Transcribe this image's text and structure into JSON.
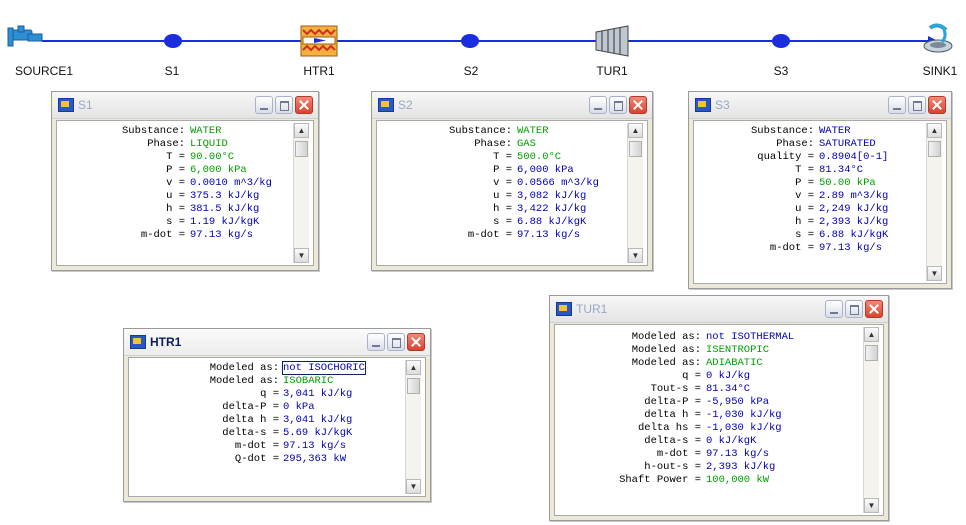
{
  "flowsheet": {
    "nodes": {
      "source": "SOURCE1",
      "s1": "S1",
      "htr": "HTR1",
      "s2": "S2",
      "tur": "TUR1",
      "s3": "S3",
      "sink": "SINK1"
    },
    "line_color": "#1a2ee0"
  },
  "win_s1": {
    "title": "S1",
    "rows": [
      {
        "label": "Substance:",
        "value": "WATER"
      },
      {
        "label": "Phase:",
        "value": "LIQUID"
      },
      {
        "label": "T =",
        "value": "90.00°C"
      },
      {
        "label": "P =",
        "value": "6,000 kPa"
      },
      {
        "label": "v =",
        "value": "0.0010 m^3/kg"
      },
      {
        "label": "u =",
        "value": "375.3 kJ/kg"
      },
      {
        "label": "h =",
        "value": "381.5 kJ/kg"
      },
      {
        "label": "s =",
        "value": "1.19 kJ/kgK"
      },
      {
        "label": "m-dot =",
        "value": "97.13 kg/s"
      }
    ]
  },
  "win_s2": {
    "title": "S2",
    "rows": [
      {
        "label": "Substance:",
        "value": "WATER"
      },
      {
        "label": "Phase:",
        "value": "GAS"
      },
      {
        "label": "T =",
        "value": "500.0°C"
      },
      {
        "label": "P =",
        "value": "6,000 kPa"
      },
      {
        "label": "v =",
        "value": "0.0566 m^3/kg"
      },
      {
        "label": "u =",
        "value": "3,082 kJ/kg"
      },
      {
        "label": "h =",
        "value": "3,422 kJ/kg"
      },
      {
        "label": "s =",
        "value": "6.88 kJ/kgK"
      },
      {
        "label": "m-dot =",
        "value": "97.13 kg/s"
      }
    ]
  },
  "win_s3": {
    "title": "S3",
    "rows": [
      {
        "label": "Substance:",
        "value": "WATER"
      },
      {
        "label": "Phase:",
        "value": "SATURATED"
      },
      {
        "label": "quality =",
        "value": "0.8904[0-1]"
      },
      {
        "label": "T =",
        "value": "81.34°C"
      },
      {
        "label": "P =",
        "value": "50.00 kPa"
      },
      {
        "label": "v =",
        "value": "2.89 m^3/kg"
      },
      {
        "label": "u =",
        "value": "2,249 kJ/kg"
      },
      {
        "label": "h =",
        "value": "2,393 kJ/kg"
      },
      {
        "label": "s =",
        "value": "6.88 kJ/kgK"
      },
      {
        "label": "m-dot =",
        "value": "97.13 kg/s"
      }
    ]
  },
  "win_htr": {
    "title": "HTR1",
    "rows": [
      {
        "label": "Modeled as:",
        "value": "not ISOCHORIC"
      },
      {
        "label": "Modeled as:",
        "value": "ISOBARIC"
      },
      {
        "label": "q =",
        "value": "3,041 kJ/kg"
      },
      {
        "label": "delta-P =",
        "value": "0 kPa"
      },
      {
        "label": "delta h =",
        "value": "3,041 kJ/kg"
      },
      {
        "label": "delta-s =",
        "value": "5.69 kJ/kgK"
      },
      {
        "label": "m-dot =",
        "value": "97.13 kg/s"
      },
      {
        "label": "Q-dot =",
        "value": "295,363 kW"
      }
    ]
  },
  "win_tur": {
    "title": "TUR1",
    "rows": [
      {
        "label": "Modeled as:",
        "value": "not ISOTHERMAL"
      },
      {
        "label": "Modeled as:",
        "value": "ISENTROPIC"
      },
      {
        "label": "Modeled as:",
        "value": "ADIABATIC"
      },
      {
        "label": "q =",
        "value": "0 kJ/kg"
      },
      {
        "label": "Tout-s =",
        "value": "81.34°C"
      },
      {
        "label": "delta-P =",
        "value": "-5,950 kPa"
      },
      {
        "label": "delta h =",
        "value": "-1,030 kJ/kg"
      },
      {
        "label": "delta hs =",
        "value": "-1,030 kJ/kg"
      },
      {
        "label": "delta-s =",
        "value": "0 kJ/kgK"
      },
      {
        "label": "m-dot =",
        "value": "97.13 kg/s"
      },
      {
        "label": "h-out-s =",
        "value": "2,393 kJ/kg"
      },
      {
        "label": "Shaft Power =",
        "value": "100,000 kW"
      }
    ]
  },
  "scroll": {
    "up": "▲",
    "down": "▼"
  }
}
